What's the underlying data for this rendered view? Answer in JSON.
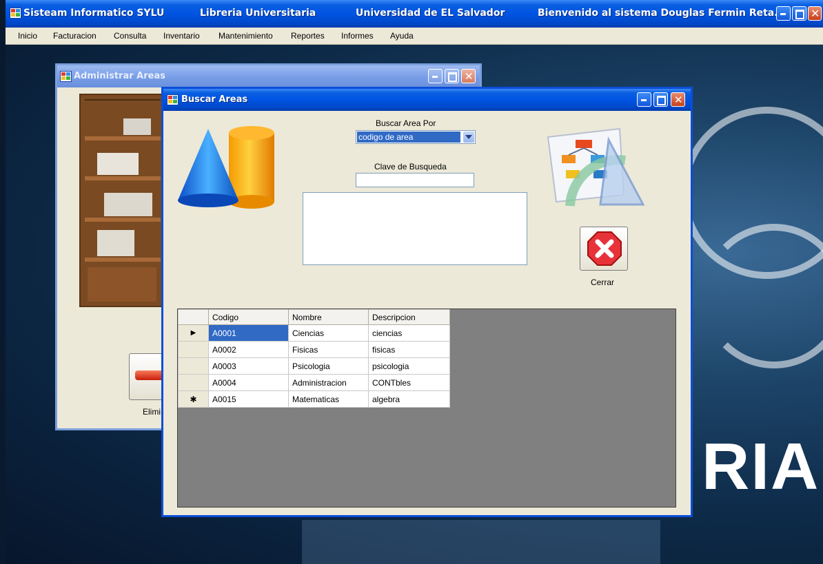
{
  "app": {
    "title_segments": [
      "Sisteam Informatico SYLU",
      "Libreria Universitaria",
      "Universidad de EL Salvador",
      "Bienvenido al sistema Douglas Fermin Reta..."
    ],
    "menu": [
      "Inicio",
      "Facturacion",
      "Consulta",
      "Inventario",
      "Mantenimiento",
      "Reportes",
      "Informes",
      "Ayuda"
    ],
    "wallpaper_text": "RIA"
  },
  "admin_window": {
    "title": "Administrar Areas",
    "delete_label": "Elimi"
  },
  "search_window": {
    "title": "Buscar Areas",
    "search_by_label": "Buscar Area Por",
    "search_by_value": "codigo de area",
    "search_key_label": "Clave de Busqueda",
    "search_key_value": "",
    "close_label": "Cerrar",
    "grid": {
      "columns": [
        "Codigo",
        "Nombre",
        "Descripcion"
      ],
      "rows": [
        {
          "indicator": "▶",
          "cells": [
            "A0001",
            "Ciencias",
            "ciencias"
          ]
        },
        {
          "indicator": "",
          "cells": [
            "A0002",
            "Fisicas",
            "fisicas"
          ]
        },
        {
          "indicator": "",
          "cells": [
            "A0003",
            "Psicologia",
            "psicologia"
          ]
        },
        {
          "indicator": "",
          "cells": [
            "A0004",
            "Administracion",
            "CONTbles"
          ]
        },
        {
          "indicator": "✱",
          "cells": [
            "A0015",
            "Matematicas",
            "algebra"
          ]
        }
      ]
    }
  },
  "colors": {
    "xp_blue": "#0054e3",
    "window_face": "#ece9d8",
    "selection": "#316ac5",
    "grid_background": "#808080"
  }
}
